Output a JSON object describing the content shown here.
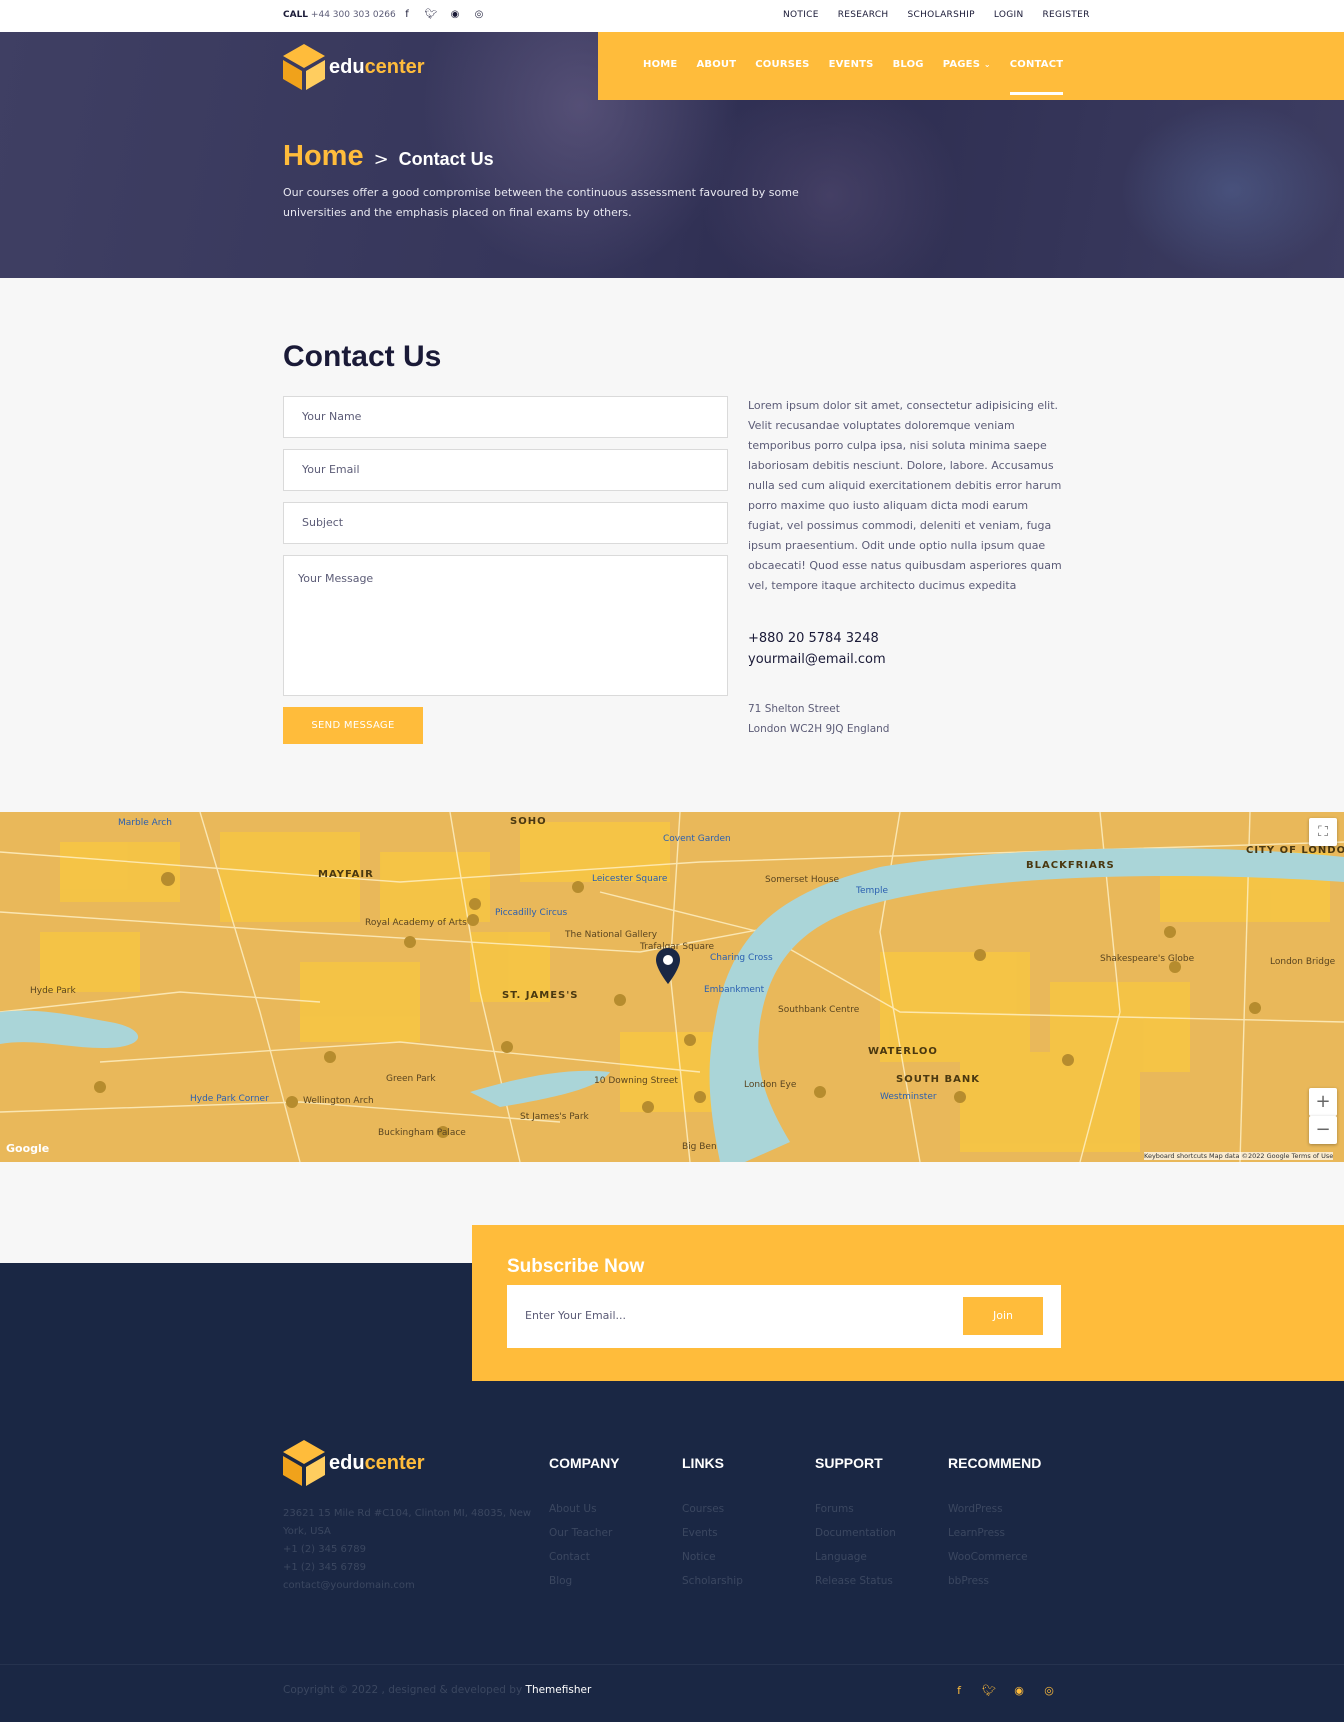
{
  "topbar": {
    "call_label": "CALL",
    "phone": "+44 300 303 0266",
    "links": [
      "NOTICE",
      "RESEARCH",
      "SCHOLARSHIP",
      "LOGIN",
      "REGISTER"
    ]
  },
  "brand": {
    "part1": "edu",
    "part2": "center"
  },
  "nav": [
    "HOME",
    "ABOUT",
    "COURSES",
    "EVENTS",
    "BLOG",
    "PAGES",
    "CONTACT"
  ],
  "hero": {
    "home": "Home",
    "separator": ">",
    "current": "Contact Us",
    "text": "Our courses offer a good compromise between the continuous assessment favoured by some universities and the emphasis placed on final exams by others."
  },
  "contact": {
    "title": "Contact Us",
    "name_ph": "Your Name",
    "email_ph": "Your Email",
    "subject_ph": "Subject",
    "message_ph": "Your Message",
    "send": "SEND MESSAGE",
    "paragraph": "Lorem ipsum dolor sit amet, consectetur adipisicing elit. Velit recusandae voluptates doloremque veniam temporibus porro culpa ipsa, nisi soluta minima saepe laboriosam debitis nesciunt. Dolore, labore. Accusamus nulla sed cum aliquid exercitationem debitis error harum porro maxime quo iusto aliquam dicta modi earum fugiat, vel possimus commodi, deleniti et veniam, fuga ipsum praesentium. Odit unde optio nulla ipsum quae obcaecati! Quod esse natus quibusdam asperiores quam vel, tempore itaque architecto ducimus expedita",
    "phone": "+880 20 5784 3248",
    "email": "yourmail@email.com",
    "address1": "71 Shelton Street",
    "address2": "London WC2H 9JQ England"
  },
  "map": {
    "labels": [
      "SOHO",
      "MAYFAIR",
      "ST. JAMES'S",
      "BLACKFRIARS",
      "CITY OF LONDON",
      "WATERLOO",
      "SOUTH BANK",
      "Trafalgar Square",
      "The National Gallery",
      "Buckingham Palace",
      "Green Park",
      "Hyde Park",
      "St James's Park",
      "London Eye",
      "Southbank Centre",
      "Somerset House",
      "Piccadilly Circus",
      "Covent Garden",
      "Leicester Square",
      "Embankment",
      "Charing Cross",
      "10 Downing Street",
      "London Bridge",
      "Shakespeare's Globe",
      "Temple",
      "Marble Arch",
      "Royal Academy of Arts",
      "Hyde Park Corner",
      "Wellington Arch",
      "Westminster",
      "Big Ben"
    ],
    "google": "Google",
    "footer_text": "Keyboard shortcuts   Map data ©2022 Google   Terms of Use",
    "zoom_in": "+",
    "zoom_out": "−",
    "fullscreen": "⛶"
  },
  "subscribe": {
    "title": "Subscribe Now",
    "placeholder": "Enter Your Email...",
    "button": "Join"
  },
  "footer": {
    "address": "23621 15 Mile Rd #C104, Clinton MI, 48035, New York, USA",
    "phone1": "+1 (2) 345 6789",
    "phone2": "+1 (2) 345 6789",
    "email": "contact@yourdomain.com",
    "columns": [
      {
        "title": "COMPANY",
        "items": [
          "About Us",
          "Our Teacher",
          "Contact",
          "Blog"
        ]
      },
      {
        "title": "LINKS",
        "items": [
          "Courses",
          "Events",
          "Notice",
          "Scholarship"
        ]
      },
      {
        "title": "SUPPORT",
        "items": [
          "Forums",
          "Documentation",
          "Language",
          "Release Status"
        ]
      },
      {
        "title": "RECOMMEND",
        "items": [
          "WordPress",
          "LearnPress",
          "WooCommerce",
          "bbPress"
        ]
      }
    ],
    "copyright": "Copyright © 2022 , designed & developed by",
    "author": "Themefisher"
  },
  "colors": {
    "accent": "#ffbc3b",
    "navy": "#1a2744",
    "heading": "#1a1a37"
  },
  "icons": [
    "facebook-icon",
    "twitter-icon",
    "github-icon",
    "instagram-icon",
    "chevron-down-icon",
    "map-pin-icon"
  ]
}
